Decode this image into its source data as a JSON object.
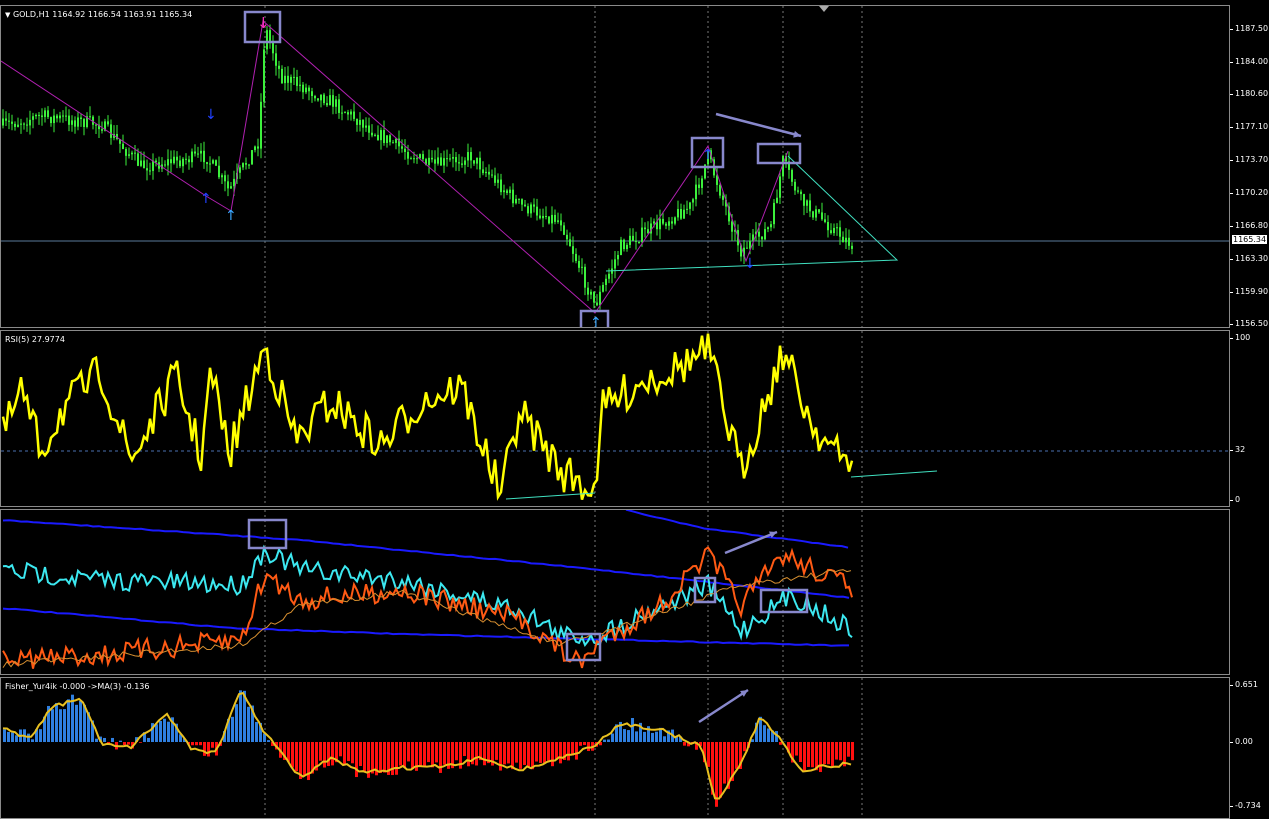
{
  "colors": {
    "bull": "#3cf03c",
    "rsi": "#ffff00",
    "cyan": "#3ce8f0",
    "orange": "#ff5a14",
    "blue": "#1a1aff",
    "fisherUp": "#2f7fe0",
    "fisherDn": "#ff1010",
    "box": "#8888cc",
    "trend": "#40e0c0",
    "zigzag": "#b020b0"
  },
  "main": {
    "title": "GOLD,H1",
    "ohlc": "1164.92 1166.54 1163.91 1165.34",
    "current": "1165.34",
    "ticks": [
      "1187.50",
      "1184.00",
      "1180.60",
      "1177.10",
      "1173.70",
      "1170.20",
      "1166.80",
      "1163.30",
      "1159.90",
      "1156.50"
    ]
  },
  "rsi": {
    "title": "RSI(5) 27.9774",
    "ticks": [
      "100",
      "32",
      "0"
    ]
  },
  "fisher": {
    "title": "Fisher_Yur4ik -0.000 ->MA(3) -0.136",
    "ticks": [
      "0.651",
      "0.00",
      "-0.734"
    ]
  },
  "icons": {
    "arrow_up": "up-arrow-icon",
    "arrow_down": "down-arrow-icon",
    "menu": "dropdown-triangle-icon"
  }
}
